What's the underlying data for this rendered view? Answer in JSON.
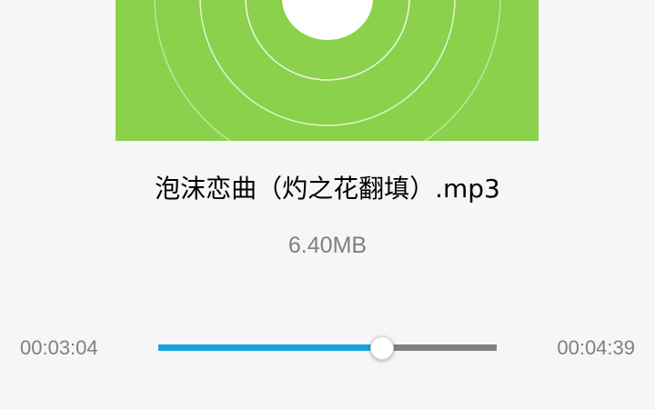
{
  "player": {
    "file_name": "泡沫恋曲（灼之花翻填）.mp3",
    "file_size": "6.40MB",
    "elapsed_time": "00:03:04",
    "total_time": "00:04:39",
    "progress_fraction": 0.66
  },
  "artwork": {
    "icon": "music-disc-icon",
    "background_color": "#8bd14b"
  },
  "colors": {
    "progress_fill": "#14a4dc",
    "progress_track": "#808080",
    "page_background": "#f6f6f8"
  }
}
